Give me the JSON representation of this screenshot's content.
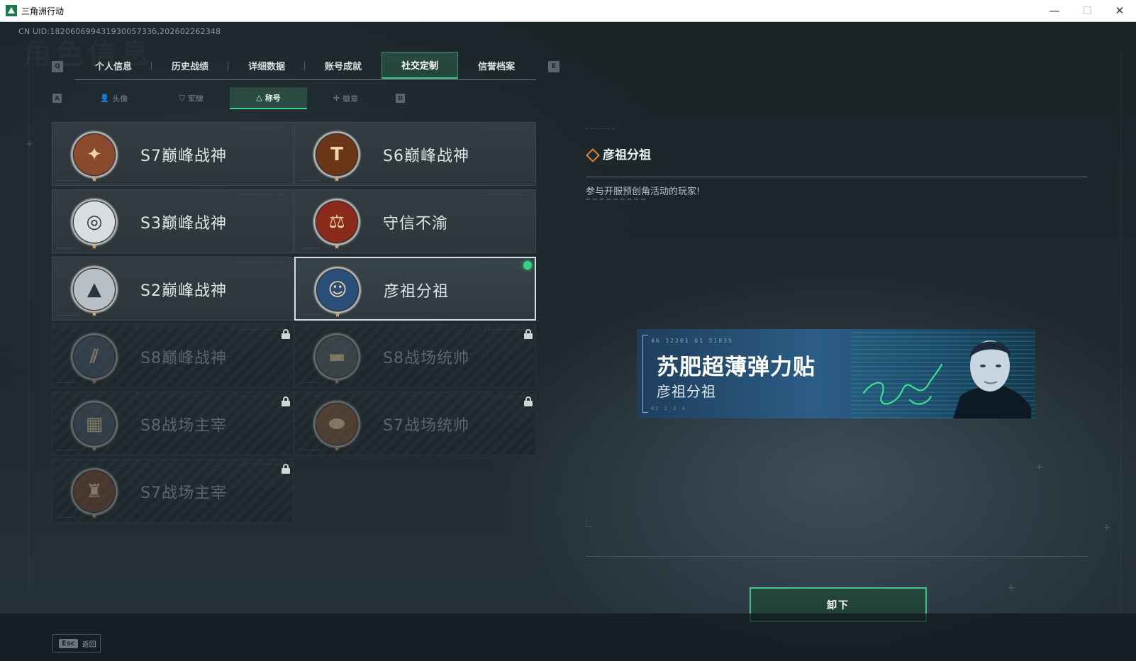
{
  "window": {
    "title": "三角洲行动",
    "minimize": "—",
    "maximize": "☐",
    "close": "✕"
  },
  "uid": "CN UID:18206069943193005733б,202602262348",
  "watermark": "角色信息",
  "keys": {
    "prev_tab": "Q",
    "next_tab": "E",
    "prev_sub": "A",
    "next_sub": "D"
  },
  "main_tabs": [
    {
      "label": "个人信息",
      "active": false
    },
    {
      "label": "历史战绩",
      "active": false
    },
    {
      "label": "详细数据",
      "active": false
    },
    {
      "label": "账号成就",
      "active": false
    },
    {
      "label": "社交定制",
      "active": true
    },
    {
      "label": "信誉档案",
      "active": false
    }
  ],
  "sub_tabs": [
    {
      "label": "头像",
      "icon": "person-icon",
      "active": false
    },
    {
      "label": "军牌",
      "icon": "dogtag-icon",
      "active": false
    },
    {
      "label": "称号",
      "icon": "title-icon",
      "active": true
    },
    {
      "label": "徽章",
      "icon": "emblem-icon",
      "active": false
    }
  ],
  "titles": [
    {
      "name": "S7巅峰战神",
      "locked": false,
      "equipped": false,
      "badge_color": "#8a4a2e",
      "badge_icon": "crossbow"
    },
    {
      "name": "S6巅峰战神",
      "locked": false,
      "equipped": false,
      "badge_color": "#6b3518",
      "badge_icon": "T"
    },
    {
      "name": "S3巅峰战神",
      "locked": false,
      "equipped": false,
      "badge_color": "#d8dde0",
      "badge_icon": "globe"
    },
    {
      "name": "守信不渝",
      "locked": false,
      "equipped": false,
      "badge_color": "#8a2a1c",
      "badge_icon": "scales"
    },
    {
      "name": "S2巅峰战神",
      "locked": false,
      "equipped": false,
      "badge_color": "#b8c0c5",
      "badge_icon": "triangle"
    },
    {
      "name": "彦祖分祖",
      "locked": false,
      "equipped": true,
      "badge_color": "#2a4f78",
      "badge_icon": "portrait"
    },
    {
      "name": "S8巅峰战神",
      "locked": true,
      "equipped": false,
      "badge_color": "#4a5a6a",
      "badge_icon": "slash"
    },
    {
      "name": "S8战场统帅",
      "locked": true,
      "equipped": false,
      "badge_color": "#5a6266",
      "badge_icon": "tank"
    },
    {
      "name": "S8战场主宰",
      "locked": true,
      "equipped": false,
      "badge_color": "#4a5866",
      "badge_icon": "rocket"
    },
    {
      "name": "S7战场统帅",
      "locked": true,
      "equipped": false,
      "badge_color": "#8a5a3a",
      "badge_icon": "vehicle"
    },
    {
      "name": "S7战场主宰",
      "locked": true,
      "equipped": false,
      "badge_color": "#7a4a30",
      "badge_icon": "soldier"
    }
  ],
  "detail": {
    "title": "彦祖分祖",
    "description": "参与开服预创角活动的玩家!"
  },
  "banner": {
    "code_top": "46 12201   61 51835",
    "main": "苏肥超薄弹力贴",
    "sub": "彦祖分祖",
    "code_bottom": "02 1 3 4"
  },
  "unequip_label": "卸下",
  "esc": {
    "key": "Esc",
    "label": "返回"
  },
  "colors": {
    "accent_green": "#3fcf8e",
    "active_tab_bg": "#2a4a42",
    "title_icon_orange": "#e2843a"
  }
}
